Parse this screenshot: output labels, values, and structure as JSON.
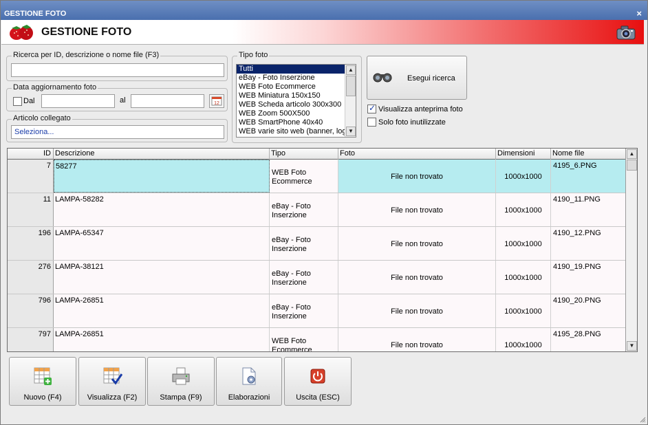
{
  "window": {
    "title": "GESTIONE FOTO",
    "close_glyph": "×"
  },
  "header": {
    "title": "GESTIONE FOTO",
    "logo_icon": "strawberry-icon",
    "camera_icon": "camera-icon"
  },
  "search": {
    "legend": "Ricerca per ID, descrizione o nome file (F3)",
    "value": ""
  },
  "date": {
    "legend": "Data aggiornamento foto",
    "from_label": "Dal",
    "from_checked": false,
    "from_value": "",
    "to_label": "al",
    "to_value": "",
    "calendar_icon": "calendar-icon"
  },
  "article": {
    "legend": "Articolo collegato",
    "value": "Seleziona..."
  },
  "photo_type": {
    "legend": "Tipo foto",
    "items": [
      "Tutti",
      "eBay - Foto Inserzione",
      "WEB Foto Ecommerce",
      "WEB Miniatura 150x150",
      "WEB Scheda articolo 300x300",
      "WEB Zoom 500X500",
      "WEB SmartPhone 40x40",
      "WEB varie sito web (banner, log"
    ],
    "selected": "Tutti"
  },
  "search_button": {
    "label": "Esegui ricerca",
    "icon": "binoculars-icon"
  },
  "options": {
    "preview_label": "Visualizza anteprima foto",
    "preview_checked": true,
    "unused_label": "Solo foto inutilizzate",
    "unused_checked": false
  },
  "table": {
    "columns": [
      "ID",
      "Descrizione",
      "Tipo",
      "Foto",
      "Dimensioni",
      "Nome file"
    ],
    "rows": [
      {
        "id": "7",
        "descrizione": "58277",
        "tipo": "WEB Foto Ecommerce",
        "foto": "File non trovato",
        "dimensioni": "1000x1000",
        "nome_file": "4195_6.PNG",
        "selected": true
      },
      {
        "id": "11",
        "descrizione": "LAMPA-58282",
        "tipo": "eBay - Foto Inserzione",
        "foto": "File non trovato",
        "dimensioni": "1000x1000",
        "nome_file": "4190_11.PNG"
      },
      {
        "id": "196",
        "descrizione": "LAMPA-65347",
        "tipo": "eBay - Foto Inserzione",
        "foto": "File non trovato",
        "dimensioni": "1000x1000",
        "nome_file": "4190_12.PNG"
      },
      {
        "id": "276",
        "descrizione": "LAMPA-38121",
        "tipo": "eBay - Foto Inserzione",
        "foto": "File non trovato",
        "dimensioni": "1000x1000",
        "nome_file": "4190_19.PNG"
      },
      {
        "id": "796",
        "descrizione": "LAMPA-26851",
        "tipo": "eBay - Foto Inserzione",
        "foto": "File non trovato",
        "dimensioni": "1000x1000",
        "nome_file": "4190_20.PNG"
      },
      {
        "id": "797",
        "descrizione": "LAMPA-26851",
        "tipo": "WEB Foto Ecommerce",
        "foto": "File non trovato",
        "dimensioni": "1000x1000",
        "nome_file": "4195_28.PNG"
      }
    ]
  },
  "toolbar": [
    {
      "label": "Nuovo (F4)",
      "icon": "grid-add-icon"
    },
    {
      "label": "Visualizza (F2)",
      "icon": "grid-check-icon"
    },
    {
      "label": "Stampa (F9)",
      "icon": "printer-icon"
    },
    {
      "label": "Elaborazioni",
      "icon": "document-gear-icon"
    },
    {
      "label": "Uscita (ESC)",
      "icon": "power-icon"
    }
  ],
  "colors": {
    "titlebar": "#4a6fae",
    "header_red": "#e81010",
    "selected_row": "#b6ecf0",
    "list_selection": "#0a246a"
  }
}
